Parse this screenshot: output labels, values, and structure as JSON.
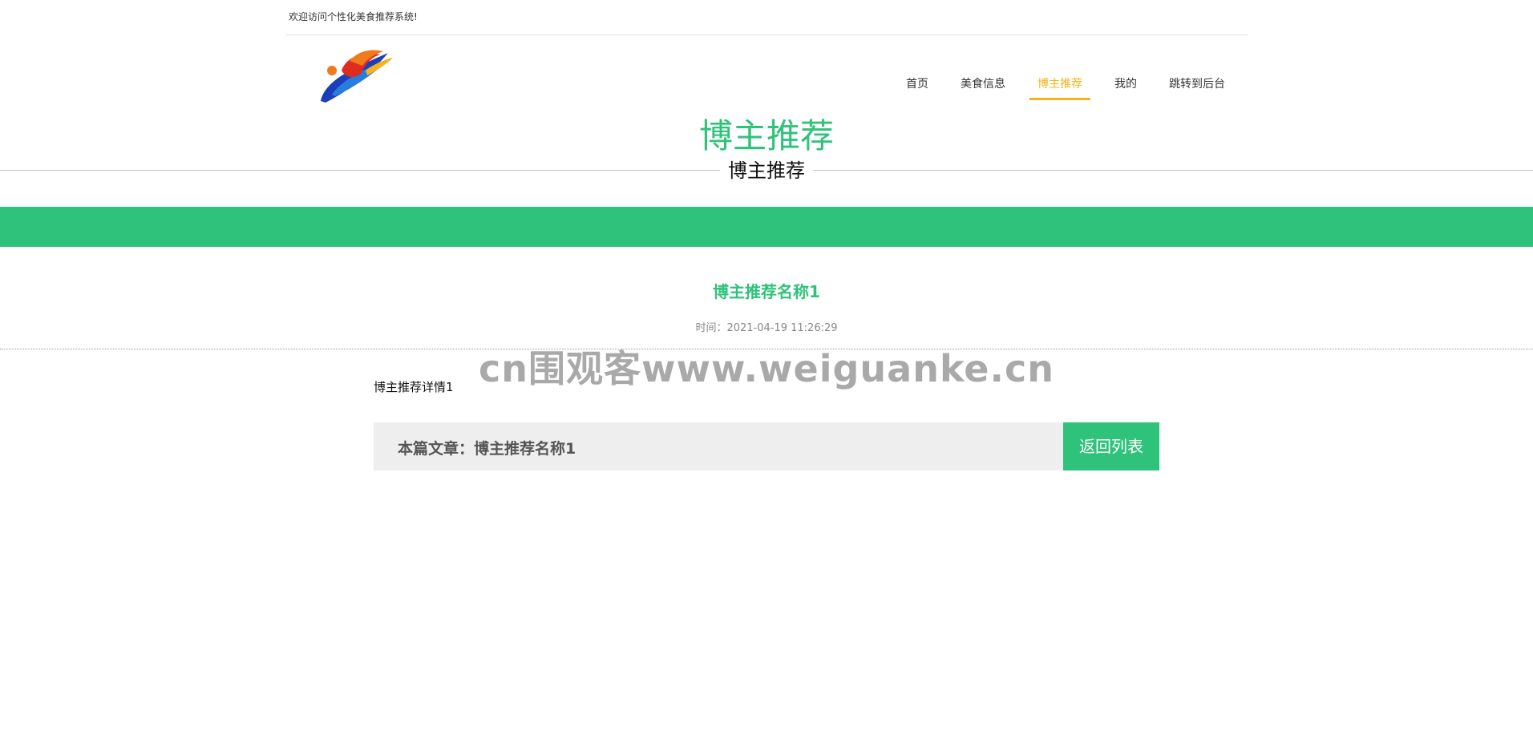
{
  "topbar": {
    "welcome_text": "欢迎访问个性化美食推荐系统!"
  },
  "logo": {
    "icon": "logo-icon",
    "colors": {
      "blue": "#1b3fb8",
      "orange": "#f07a1c",
      "red": "#e02b20",
      "yellow": "#f5b21b"
    }
  },
  "nav": {
    "items": [
      {
        "label": "首页"
      },
      {
        "label": "美食信息"
      },
      {
        "label": "博主推荐",
        "active": true
      },
      {
        "label": "我的"
      },
      {
        "label": "跳转到后台"
      }
    ],
    "active_color": "#f5b21b"
  },
  "header": {
    "title": "博主推荐",
    "subtitle": "博主推荐"
  },
  "theme": {
    "accent": "#2ec27a"
  },
  "article": {
    "title": "博主推荐名称1",
    "time": "时间：2021-04-19 11:26:29",
    "body": "博主推荐详情1"
  },
  "watermark": {
    "text": "cn围观客www.weiguanke.cn"
  },
  "footer_bar": {
    "label": "本篇文章：博主推荐名称1",
    "back_label": "返回列表"
  }
}
